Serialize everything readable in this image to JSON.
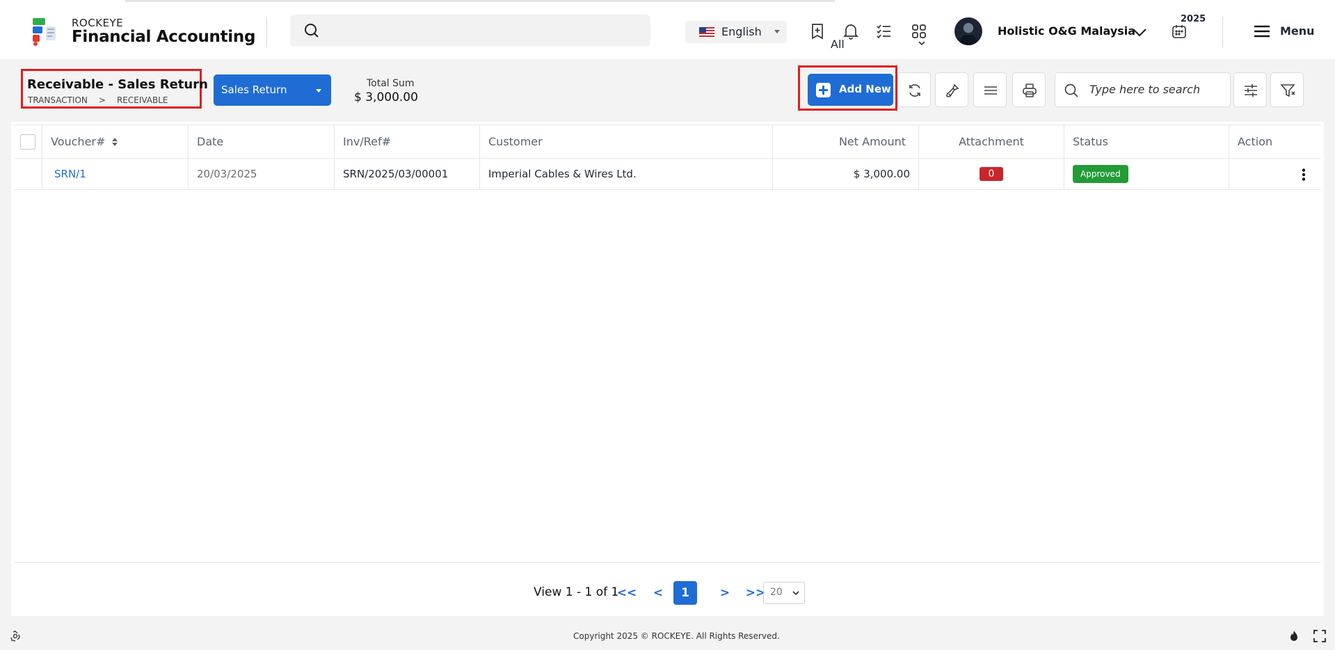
{
  "app": {
    "brand_small": "ROCKEYE",
    "brand_title": "Financial Accounting"
  },
  "search": {
    "placeholder": "",
    "scope": "All"
  },
  "language": {
    "label": "English",
    "flag_icon": "us-flag-icon"
  },
  "header_icons": [
    "bookmark-add-icon",
    "bell-icon",
    "checklist-icon",
    "apps-grid-icon"
  ],
  "user": {
    "company": "Holistic O&G Malaysia"
  },
  "fiscal": {
    "year": "2025"
  },
  "menu": {
    "label": "Menu"
  },
  "page": {
    "title": "Receivable - Sales Return",
    "breadcrumb": [
      "TRANSACTION",
      ">",
      "RECEIVABLE"
    ]
  },
  "type_dropdown": {
    "label": "Sales Return"
  },
  "total": {
    "label": "Total Sum",
    "value": "$ 3,000.00"
  },
  "toolbar": {
    "add_new": "Add New",
    "search_placeholder": "Type here to search",
    "buttons": [
      "refresh-icon",
      "clear-brush-icon",
      "columns-icon",
      "print-icon",
      "settings-sliders-icon",
      "filter-icon"
    ]
  },
  "table": {
    "columns": [
      "Voucher#",
      "Date",
      "Inv/Ref#",
      "Customer",
      "Net Amount",
      "Attachment",
      "Status",
      "Action"
    ],
    "rows": [
      {
        "voucher": "SRN/1",
        "date": "20/03/2025",
        "ref": "SRN/2025/03/00001",
        "customer": "Imperial Cables & Wires Ltd.",
        "net_amount": "$ 3,000.00",
        "attachment": "0",
        "status": "Approved"
      }
    ]
  },
  "pager": {
    "view": "View 1 - 1 of 1",
    "first": "<<",
    "prev": "<",
    "current": "1",
    "next": ">",
    "last": ">>",
    "page_size": "20"
  },
  "footer": {
    "copyright": "Copyright 2025 © ROCKEYE. All Rights Reserved."
  },
  "colors": {
    "primary": "#1f6cd4",
    "highlight": "#e01d1d",
    "approved": "#239b37",
    "attachment_badge": "#c9262b"
  }
}
